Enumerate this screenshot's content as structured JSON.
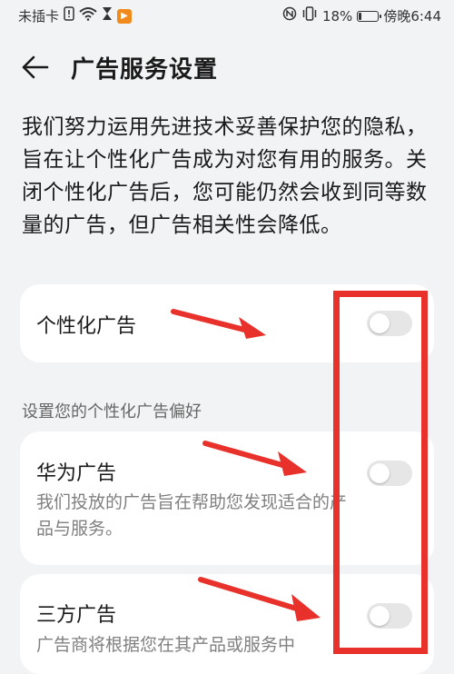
{
  "status_bar": {
    "carrier": "未插卡",
    "battery": "18%",
    "battery_level": 0.18,
    "time": "傍晚6:44",
    "icons": [
      "warning-icon",
      "wifi-icon",
      "hourglass-icon",
      "play-icon",
      "nfc-icon",
      "vibrate-icon",
      "battery-icon"
    ]
  },
  "header": {
    "title": "广告服务设置",
    "back_icon": "back-arrow-icon"
  },
  "intro": "我们努力运用先进技术妥善保护您的隐私，旨在让个性化广告成为对您有用的服务。关闭个性化广告后，您可能仍然会收到同等数量的广告，但广告相关性会降低。",
  "personalized_ads": {
    "label": "个性化广告",
    "enabled": false
  },
  "section_label": "设置您的个性化广告偏好",
  "huawei_ads": {
    "label": "华为广告",
    "description": "我们投放的广告旨在帮助您发现适合的产品与服务。",
    "enabled": false
  },
  "third_party_ads": {
    "label": "三方广告",
    "description": "广告商将根据您在其产品或服务中",
    "enabled": false
  },
  "colors": {
    "annotation": "#e8312b",
    "toggle_off": "#e6e6e6",
    "background": "#f1f3f5"
  }
}
